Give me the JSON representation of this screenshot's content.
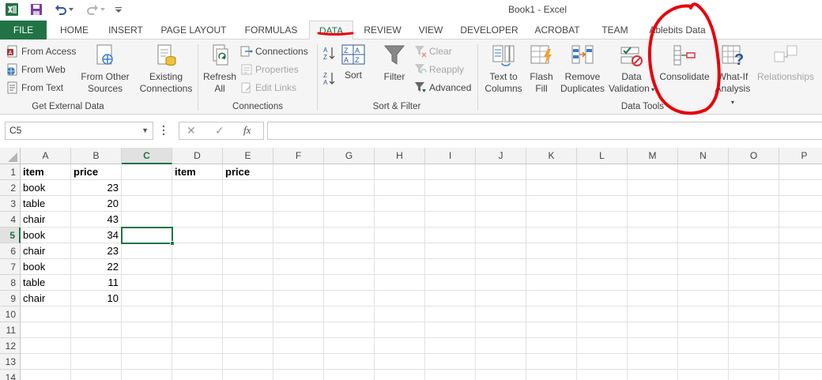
{
  "window": {
    "title": "Book1 - Excel"
  },
  "tabs": [
    {
      "id": "file",
      "label": "FILE"
    },
    {
      "id": "home",
      "label": "HOME"
    },
    {
      "id": "insert",
      "label": "INSERT"
    },
    {
      "id": "page_layout",
      "label": "PAGE LAYOUT"
    },
    {
      "id": "formulas",
      "label": "FORMULAS"
    },
    {
      "id": "data",
      "label": "DATA"
    },
    {
      "id": "review",
      "label": "REVIEW"
    },
    {
      "id": "view",
      "label": "VIEW"
    },
    {
      "id": "developer",
      "label": "DEVELOPER"
    },
    {
      "id": "acrobat",
      "label": "ACROBAT"
    },
    {
      "id": "team",
      "label": "TEAM"
    },
    {
      "id": "ablebits",
      "label": "Ablebits Data"
    }
  ],
  "active_tab": "DATA",
  "ribbon": {
    "get_external_data": {
      "label": "Get External Data",
      "from_access": "From Access",
      "from_web": "From Web",
      "from_text": "From Text",
      "from_other_sources_1": "From Other",
      "from_other_sources_2": "Sources",
      "existing_connections_1": "Existing",
      "existing_connections_2": "Connections"
    },
    "connections": {
      "label": "Connections",
      "refresh_all_1": "Refresh",
      "refresh_all_2": "All",
      "connections": "Connections",
      "properties": "Properties",
      "edit_links": "Edit Links"
    },
    "sort_filter": {
      "label": "Sort & Filter",
      "sort": "Sort",
      "filter": "Filter",
      "clear": "Clear",
      "reapply": "Reapply",
      "advanced": "Advanced"
    },
    "data_tools": {
      "label": "Data Tools",
      "text_to_columns_1": "Text to",
      "text_to_columns_2": "Columns",
      "flash_fill_1": "Flash",
      "flash_fill_2": "Fill",
      "remove_duplicates_1": "Remove",
      "remove_duplicates_2": "Duplicates",
      "data_validation_1": "Data",
      "data_validation_2": "Validation",
      "consolidate": "Consolidate",
      "what_if_1": "What-If",
      "what_if_2": "Analysis",
      "relationships": "Relationships"
    }
  },
  "formula_bar": {
    "name_box": "C5",
    "cancel_glyph": "✕",
    "enter_glyph": "✓",
    "fx_glyph": "fx",
    "formula": ""
  },
  "sheet": {
    "columns": [
      "A",
      "B",
      "C",
      "D",
      "E",
      "F",
      "G",
      "H",
      "I",
      "J",
      "K",
      "L",
      "M",
      "N",
      "O",
      "P"
    ],
    "rows": [
      "1",
      "2",
      "3",
      "4",
      "5",
      "6",
      "7",
      "8",
      "9",
      "10",
      "11",
      "12",
      "13",
      "14"
    ],
    "active_cell": "C5",
    "cells": {
      "A1": "item",
      "B1": "price",
      "D1": "item",
      "E1": "price",
      "A2": "book",
      "B2": "23",
      "A3": "table",
      "B3": "20",
      "A4": "chair",
      "B4": "43",
      "A5": "book",
      "B5": "34",
      "A6": "chair",
      "B6": "23",
      "A7": "book",
      "B7": "22",
      "A8": "table",
      "B8": "11",
      "A9": "chair",
      "B9": "10"
    }
  },
  "colors": {
    "excel_green": "#217346",
    "annotation_red": "#e8000b"
  }
}
